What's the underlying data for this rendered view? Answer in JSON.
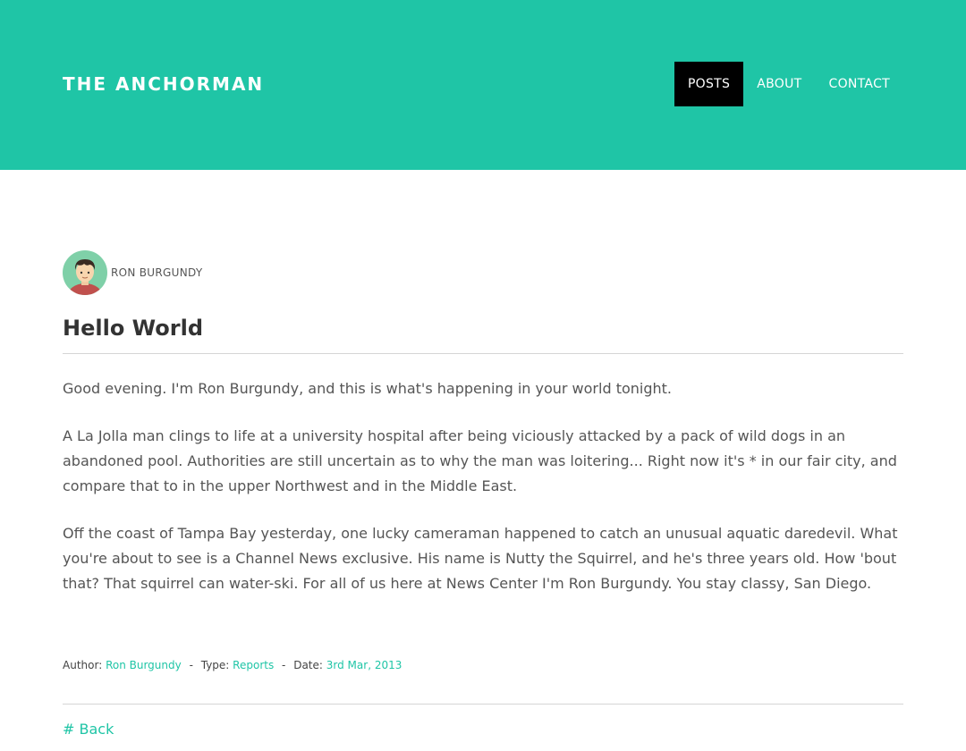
{
  "site": {
    "title": "THE ANCHORMAN"
  },
  "nav": {
    "items": [
      {
        "label": "POSTS",
        "active": true
      },
      {
        "label": "ABOUT",
        "active": false
      },
      {
        "label": "CONTACT",
        "active": false
      }
    ]
  },
  "post": {
    "author": "RON BURGUNDY",
    "title": "Hello World",
    "paragraphs": [
      "Good evening. I'm Ron Burgundy, and this is what's happening in your world tonight.",
      "A La Jolla man clings to life at a university hospital after being viciously attacked by a pack of wild dogs in an abandoned pool. Authorities are still uncertain as to why the man was loitering... Right now it's * in our fair city, and compare that to in the upper Northwest and in the Middle East.",
      "Off the coast of Tampa Bay yesterday, one lucky cameraman happened to catch an unusual aquatic daredevil. What you're about to see is a Channel News exclusive. His name is Nutty the Squirrel, and he's three years old. How 'bout that? That squirrel can water-ski. For all of us here at News Center I'm Ron Burgundy. You stay classy, San Diego."
    ],
    "meta": {
      "author_label": "Author:",
      "author_value": "Ron Burgundy",
      "separator": "-",
      "type_label": "Type:",
      "type_value": "Reports",
      "date_label": "Date:",
      "date_value": "3rd Mar, 2013"
    },
    "back_link": "# Back"
  },
  "colors": {
    "accent": "#1fc5a6",
    "nav_active_bg": "#000000",
    "header_text": "#ffffff",
    "body_text": "#555555"
  },
  "icons": {
    "avatar": "user-avatar-icon"
  }
}
